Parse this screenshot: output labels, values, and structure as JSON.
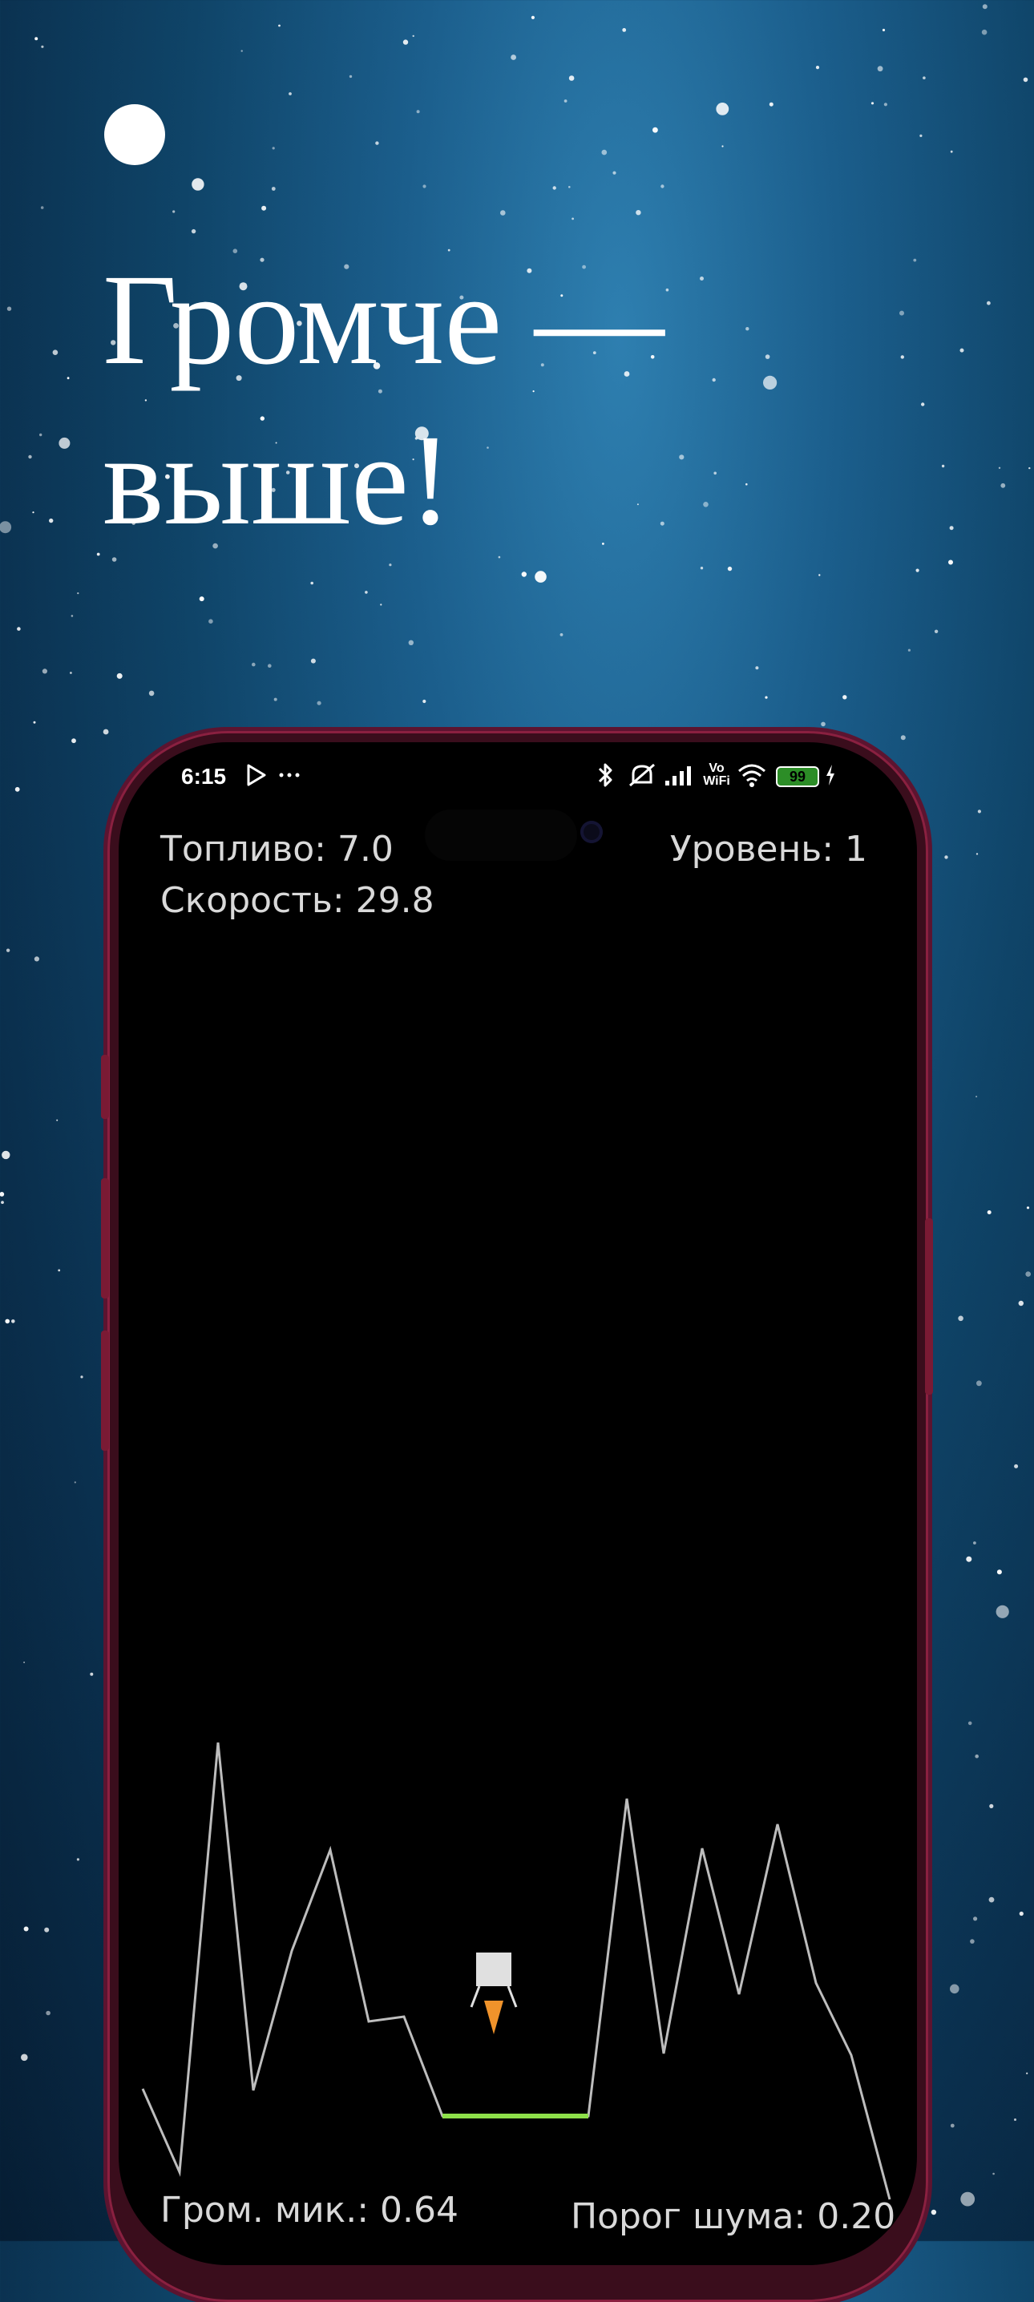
{
  "headline": {
    "line1": "Громче —",
    "line2": "выше!"
  },
  "status_bar": {
    "time": "6:15",
    "vowifi_label": "Vo\nWiFi",
    "battery_level": "99"
  },
  "hud": {
    "fuel_label": "Топливо: 7.0",
    "level_label": "Уровень: 1",
    "speed_label": "Скорость: 29.8",
    "mic_volume_label": "Гром. мик.: 0.64",
    "noise_threshold_label": "Порог шума: 0.20"
  },
  "colors": {
    "terrain": "#bdbdbd",
    "landing_pad": "#8ee04a",
    "lander_body": "#e0e0e0",
    "flame": "#f0932b",
    "hud_text": "#d9d9d9"
  }
}
